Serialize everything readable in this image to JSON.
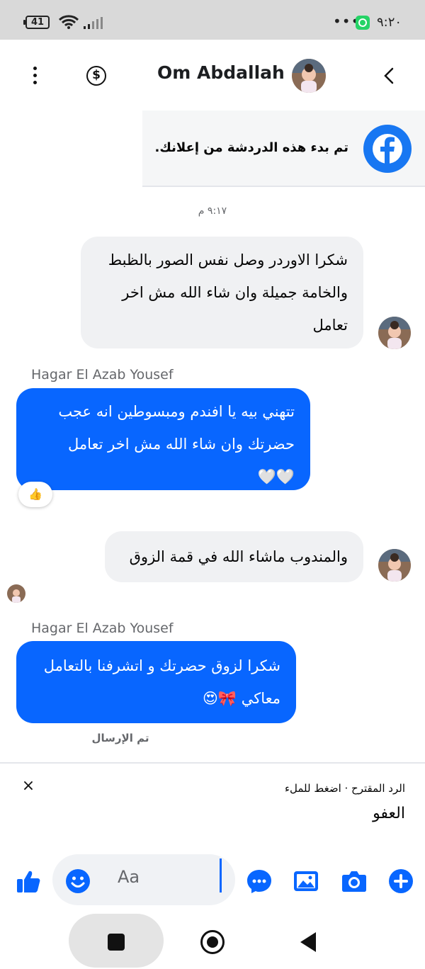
{
  "status_bar": {
    "battery": "41",
    "time": "٩:٢٠",
    "icons": [
      "battery-icon",
      "wifi-icon",
      "signal-icon",
      "more-dots-icon",
      "whatsapp-icon"
    ]
  },
  "header": {
    "title": "Om Abdallah",
    "icons": [
      "more-vertical-icon",
      "payment-dollar-icon",
      "back-chevron-icon"
    ]
  },
  "ad_banner": {
    "text": "تم بدء هذه الدردشة من إعلانك.",
    "icon": "facebook-logo-icon"
  },
  "chat": {
    "timestamp": "٩:١٧ م",
    "messages": [
      {
        "direction": "incoming",
        "lines": [
          "شكرا الاوردر وصل نفس الصور بالظبط",
          "والخامة جميلة وان شاء الله مش اخر",
          "تعامل"
        ]
      },
      {
        "direction": "outgoing",
        "sender": "Hagar El Azab Yousef",
        "lines": [
          "تتهني بيه يا افندم ومبسوطين انه عجب",
          "حضرتك وان شاء الله مش اخر تعامل",
          "🤍🤍"
        ],
        "reaction": "👍"
      },
      {
        "direction": "incoming",
        "lines": [
          "والمندوب ماشاء الله في قمة الزوق"
        ]
      },
      {
        "direction": "outgoing",
        "sender": "Hagar El Azab Yousef",
        "lines": [
          "شكرا لزوق حضرتك و اتشرفنا بالتعامل",
          "معاكي 🎀😍"
        ]
      }
    ],
    "sent_status": "تم الإرسال"
  },
  "suggested_reply": {
    "hint": "الرد المقترح · اضغط للملء",
    "text": "العفو",
    "close_label": "×"
  },
  "composer": {
    "placeholder": "Aa",
    "icons": [
      "like-thumb-icon",
      "emoji-icon",
      "chat-bubble-more-icon",
      "image-gallery-icon",
      "camera-icon",
      "plus-icon"
    ]
  },
  "colors": {
    "accent": "#0866ff",
    "incoming_bubble": "#f0f1f3",
    "secondary_text": "#65676b"
  }
}
